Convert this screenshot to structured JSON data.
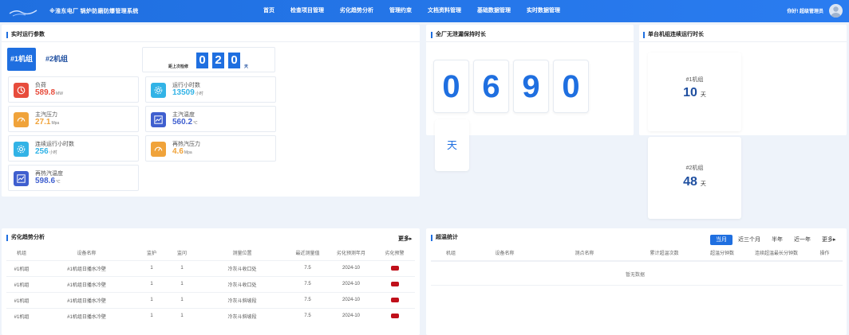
{
  "header": {
    "title": "※淮东电厂 锅炉防磨防爆管理系统",
    "nav": [
      "首页",
      "检查项目管理",
      "劣化趋势分析",
      "管理约束",
      "文档资料管理",
      "基础数据管理",
      "实时数据管理"
    ],
    "user": "你好! 超级管理员",
    "bar_color": "#1f6fe0"
  },
  "realtime": {
    "title": "实时运行参数",
    "tabs": [
      "#1机组",
      "#2机组"
    ],
    "overhaul_label": "距上次检修",
    "overhaul_digits": [
      "0",
      "2",
      "0"
    ],
    "overhaul_unit": "天",
    "metrics": [
      {
        "label": "负荷",
        "value": "589.8",
        "unit": "MW",
        "color": "#e74c3c",
        "icon": "load-icon"
      },
      {
        "label": "运行小时数",
        "value": "13509",
        "unit": "小时",
        "color": "#32b3e6",
        "icon": "runtime-icon"
      },
      {
        "label": "主汽压力",
        "value": "27.1",
        "unit": "Mpa",
        "color": "#f0a33a",
        "icon": "gauge-icon"
      },
      {
        "label": "主汽温度",
        "value": "560.2",
        "unit": "℃",
        "color": "#3f5fcf",
        "icon": "trend-icon"
      },
      {
        "label": "连续运行小时数",
        "value": "256",
        "unit": "小时",
        "color": "#32b3e6",
        "icon": "runtime-icon"
      },
      {
        "label": "再热汽压力",
        "value": "4.6",
        "unit": "Mpa",
        "color": "#f0a33a",
        "icon": "gauge-icon"
      },
      {
        "label": "再热汽温度",
        "value": "598.6",
        "unit": "℃",
        "color": "#3f5fcf",
        "icon": "trend-icon"
      }
    ]
  },
  "leak_free": {
    "title": "全厂无泄漏保持时长",
    "digits": [
      "0",
      "6",
      "9",
      "0"
    ],
    "unit": "天"
  },
  "continuous": {
    "title": "单台机组连续运行时长",
    "units": [
      {
        "name": "#1机组",
        "value": "10",
        "unit": "天"
      },
      {
        "name": "#2机组",
        "value": "48",
        "unit": "天"
      }
    ]
  },
  "trend": {
    "title": "劣化趋势分析",
    "more": "更多",
    "columns": [
      "机组",
      "设备名称",
      "监护",
      "监问",
      "测量位置",
      "最近测量值",
      "劣化预测年月",
      "劣化预警"
    ],
    "rows": [
      [
        "#1机组",
        "#1机组日播水冷壁",
        "1",
        "1",
        "冷灰斗收口处",
        "7.5",
        "2024-10"
      ],
      [
        "#1机组",
        "#1机组日播水冷壁",
        "1",
        "1",
        "冷灰斗收口处",
        "7.5",
        "2024-10"
      ],
      [
        "#1机组",
        "#1机组日播水冷壁",
        "1",
        "1",
        "冷灰斗斜坡段",
        "7.5",
        "2024-10"
      ],
      [
        "#1机组",
        "#1机组日播水冷壁",
        "1",
        "1",
        "冷灰斗斜坡段",
        "7.5",
        "2024-10"
      ]
    ],
    "warn_color": "#c0101a"
  },
  "overtemp": {
    "title": "超温统计",
    "filters": [
      "当月",
      "近三个月",
      "半年",
      "近一年",
      "更多"
    ],
    "columns": [
      "机组",
      "设备名称",
      "测点名称",
      "累计超温次数",
      "超温分钟数",
      "连续超温最长分钟数",
      "操作"
    ],
    "empty": "暂无数据"
  }
}
